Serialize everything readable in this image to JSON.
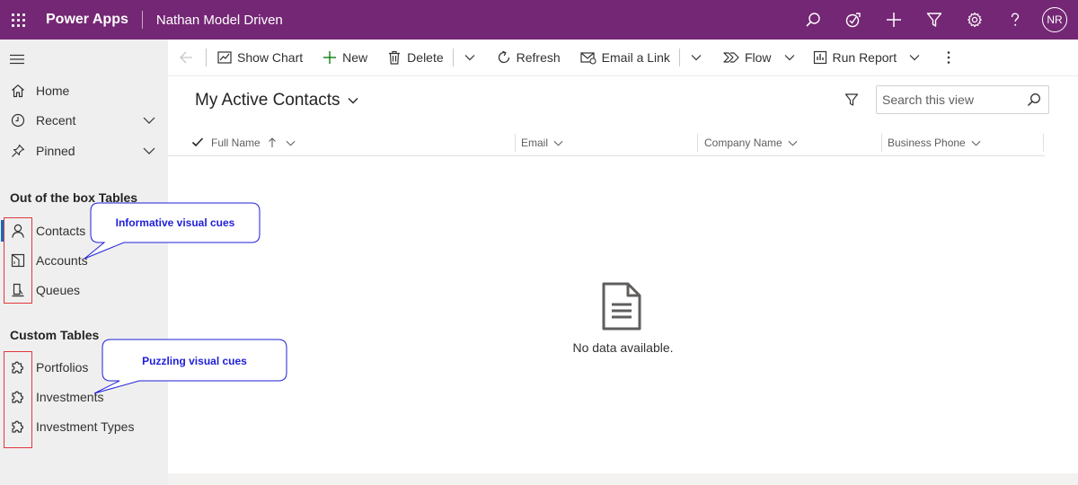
{
  "topbar": {
    "app_name": "Power Apps",
    "environment_name": "Nathan Model Driven",
    "avatar_initials": "NR",
    "background_color": "#742774",
    "icons": [
      "search-icon",
      "assistant-icon",
      "add-icon",
      "filter-icon",
      "settings-icon",
      "help-icon"
    ]
  },
  "sidebar": {
    "menu_icon": "hamburger-icon",
    "top_items": [
      {
        "label": "Home",
        "icon": "home-icon"
      },
      {
        "label": "Recent",
        "icon": "clock-icon",
        "has_chevron": true
      },
      {
        "label": "Pinned",
        "icon": "pin-icon",
        "has_chevron": true
      }
    ],
    "groups": [
      {
        "title": "Out of the box Tables",
        "items": [
          {
            "label": "Contacts",
            "icon": "person-icon",
            "selected": true
          },
          {
            "label": "Accounts",
            "icon": "accounts-icon"
          },
          {
            "label": "Queues",
            "icon": "queue-icon"
          }
        ]
      },
      {
        "title": "Custom Tables",
        "items": [
          {
            "label": "Portfolios",
            "icon": "puzzle-icon"
          },
          {
            "label": "Investments",
            "icon": "puzzle-icon"
          },
          {
            "label": "Investment Types",
            "icon": "puzzle-icon"
          }
        ]
      }
    ]
  },
  "commandbar": {
    "back_icon": "back-arrow-icon",
    "items": [
      {
        "label": "Show Chart",
        "icon": "chart-icon"
      },
      {
        "label": "New",
        "icon": "plus-icon"
      },
      {
        "label": "Delete",
        "icon": "trash-icon"
      },
      {
        "label": "Refresh",
        "icon": "refresh-icon"
      },
      {
        "label": "Email a Link",
        "icon": "email-link-icon"
      },
      {
        "label": "Flow",
        "icon": "flow-icon"
      },
      {
        "label": "Run Report",
        "icon": "report-icon"
      }
    ],
    "more_icon": "more-vertical-icon"
  },
  "view": {
    "title": "My Active Contacts",
    "search_placeholder": "Search this view",
    "columns": [
      {
        "label": "Full Name",
        "sorted": "ascending"
      },
      {
        "label": "Email"
      },
      {
        "label": "Company Name"
      },
      {
        "label": "Business Phone"
      }
    ],
    "empty_message": "No data available.",
    "empty_icon": "document-icon"
  },
  "annotations": {
    "callout_1": "Informative visual cues",
    "callout_2": "Puzzling visual cues",
    "highlight_color": "#e0383e",
    "callout_text_color": "#1f1fd8"
  }
}
